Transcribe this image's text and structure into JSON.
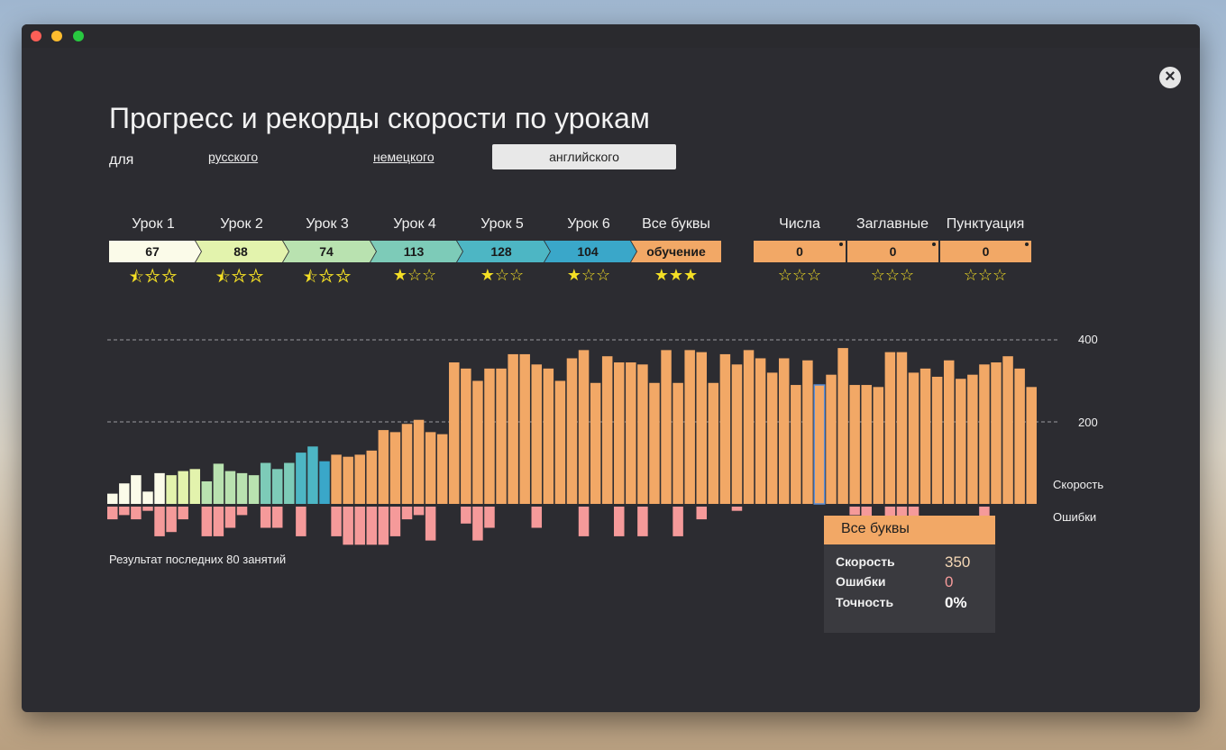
{
  "window": {
    "title": ""
  },
  "page_title": "Прогресс и рекорды скорости по урокам",
  "for_label": "для",
  "languages": [
    {
      "label": "русского",
      "selected": false
    },
    {
      "label": "немецкого",
      "selected": false
    },
    {
      "label": "английского",
      "selected": true
    }
  ],
  "lessons": [
    {
      "label": "Урок 1",
      "value": "67",
      "stars": "half",
      "color": "#fbfbe9"
    },
    {
      "label": "Урок 2",
      "value": "88",
      "stars": "half",
      "color": "#e3f3ad"
    },
    {
      "label": "Урок 3",
      "value": "74",
      "stars": "half",
      "color": "#b9e2b0"
    },
    {
      "label": "Урок 4",
      "value": "113",
      "stars": "one",
      "color": "#7dcbb8"
    },
    {
      "label": "Урок 5",
      "value": "128",
      "stars": "one",
      "color": "#4db6c4"
    },
    {
      "label": "Урок 6",
      "value": "104",
      "stars": "one",
      "color": "#3aa7c9"
    },
    {
      "label": "Все буквы",
      "value": "обучение",
      "stars": "three",
      "color": "#f2a866"
    }
  ],
  "extras": [
    {
      "label": "Числа",
      "value": "0",
      "stars": "zero"
    },
    {
      "label": "Заглавные",
      "value": "0",
      "stars": "zero"
    },
    {
      "label": "Пунктуация",
      "value": "0",
      "stars": "zero"
    }
  ],
  "star_glyphs": {
    "half": "⯪☆☆",
    "one": "★☆☆",
    "three": "★★★",
    "zero": "☆☆☆"
  },
  "chart_data": {
    "type": "bar",
    "y_ticks": [
      "400",
      "200"
    ],
    "ylim": [
      0,
      400
    ],
    "speed_label": "Скорость",
    "errors_label": "Ошибки",
    "colors": [
      "#fbfbe9",
      "#e3f3ad",
      "#b9e2b0",
      "#7dcbb8",
      "#4db6c4",
      "#3aa7c9",
      "#f2a866"
    ],
    "error_color": "#f59a9a",
    "bars": [
      {
        "v": 25,
        "g": 0,
        "e": 3
      },
      {
        "v": 50,
        "g": 0,
        "e": 2
      },
      {
        "v": 70,
        "g": 0,
        "e": 3
      },
      {
        "v": 30,
        "g": 0,
        "e": 1
      },
      {
        "v": 75,
        "g": 0,
        "e": 7
      },
      {
        "v": 70,
        "g": 1,
        "e": 6
      },
      {
        "v": 80,
        "g": 1,
        "e": 3
      },
      {
        "v": 85,
        "g": 1,
        "e": 0
      },
      {
        "v": 55,
        "g": 2,
        "e": 7
      },
      {
        "v": 98,
        "g": 2,
        "e": 7
      },
      {
        "v": 80,
        "g": 2,
        "e": 5
      },
      {
        "v": 75,
        "g": 2,
        "e": 2
      },
      {
        "v": 70,
        "g": 2,
        "e": 0
      },
      {
        "v": 100,
        "g": 3,
        "e": 5
      },
      {
        "v": 85,
        "g": 3,
        "e": 5
      },
      {
        "v": 100,
        "g": 3,
        "e": 0
      },
      {
        "v": 125,
        "g": 4,
        "e": 7
      },
      {
        "v": 140,
        "g": 4,
        "e": 0
      },
      {
        "v": 104,
        "g": 5,
        "e": 0
      },
      {
        "v": 120,
        "g": 6,
        "e": 7
      },
      {
        "v": 115,
        "g": 6,
        "e": 9
      },
      {
        "v": 120,
        "g": 6,
        "e": 9
      },
      {
        "v": 130,
        "g": 6,
        "e": 9
      },
      {
        "v": 180,
        "g": 6,
        "e": 9
      },
      {
        "v": 175,
        "g": 6,
        "e": 7
      },
      {
        "v": 195,
        "g": 6,
        "e": 3
      },
      {
        "v": 205,
        "g": 6,
        "e": 2
      },
      {
        "v": 175,
        "g": 6,
        "e": 8
      },
      {
        "v": 170,
        "g": 6,
        "e": 0
      },
      {
        "v": 345,
        "g": 6,
        "e": 0
      },
      {
        "v": 330,
        "g": 6,
        "e": 4
      },
      {
        "v": 300,
        "g": 6,
        "e": 8
      },
      {
        "v": 330,
        "g": 6,
        "e": 5
      },
      {
        "v": 330,
        "g": 6,
        "e": 0
      },
      {
        "v": 365,
        "g": 6,
        "e": 0
      },
      {
        "v": 365,
        "g": 6,
        "e": 0
      },
      {
        "v": 340,
        "g": 6,
        "e": 5
      },
      {
        "v": 330,
        "g": 6,
        "e": 0
      },
      {
        "v": 300,
        "g": 6,
        "e": 0
      },
      {
        "v": 355,
        "g": 6,
        "e": 0
      },
      {
        "v": 375,
        "g": 6,
        "e": 7
      },
      {
        "v": 295,
        "g": 6,
        "e": 0
      },
      {
        "v": 360,
        "g": 6,
        "e": 0
      },
      {
        "v": 345,
        "g": 6,
        "e": 7
      },
      {
        "v": 345,
        "g": 6,
        "e": 0
      },
      {
        "v": 340,
        "g": 6,
        "e": 7
      },
      {
        "v": 295,
        "g": 6,
        "e": 0
      },
      {
        "v": 375,
        "g": 6,
        "e": 0
      },
      {
        "v": 295,
        "g": 6,
        "e": 7
      },
      {
        "v": 375,
        "g": 6,
        "e": 0
      },
      {
        "v": 370,
        "g": 6,
        "e": 3
      },
      {
        "v": 295,
        "g": 6,
        "e": 0
      },
      {
        "v": 365,
        "g": 6,
        "e": 0
      },
      {
        "v": 340,
        "g": 6,
        "e": 1
      },
      {
        "v": 375,
        "g": 6,
        "e": 0
      },
      {
        "v": 355,
        "g": 6,
        "e": 0
      },
      {
        "v": 320,
        "g": 6,
        "e": 0
      },
      {
        "v": 355,
        "g": 6,
        "e": 0
      },
      {
        "v": 290,
        "g": 6,
        "e": 0
      },
      {
        "v": 350,
        "g": 6,
        "e": 0
      },
      {
        "v": 290,
        "g": 6,
        "e": 0
      },
      {
        "v": 315,
        "g": 6,
        "e": 0
      },
      {
        "v": 380,
        "g": 6,
        "e": 0
      },
      {
        "v": 290,
        "g": 6,
        "e": 2
      },
      {
        "v": 290,
        "g": 6,
        "e": 4
      },
      {
        "v": 285,
        "g": 6,
        "e": 0
      },
      {
        "v": 370,
        "g": 6,
        "e": 4
      },
      {
        "v": 370,
        "g": 6,
        "e": 5
      },
      {
        "v": 320,
        "g": 6,
        "e": 8
      },
      {
        "v": 330,
        "g": 6,
        "e": 0
      },
      {
        "v": 310,
        "g": 6,
        "e": 0
      },
      {
        "v": 350,
        "g": 6,
        "e": 0
      },
      {
        "v": 305,
        "g": 6,
        "e": 0
      },
      {
        "v": 315,
        "g": 6,
        "e": 0
      },
      {
        "v": 340,
        "g": 6,
        "e": 7
      },
      {
        "v": 345,
        "g": 6,
        "e": 0
      },
      {
        "v": 360,
        "g": 6,
        "e": 0
      },
      {
        "v": 330,
        "g": 6,
        "e": 0
      },
      {
        "v": 285,
        "g": 6,
        "e": 0
      }
    ],
    "highlighted_index": 60
  },
  "footer_note": "Результат последних 80 занятий",
  "tooltip": {
    "title": "Все буквы",
    "rows": [
      {
        "label": "Скорость",
        "value": "350",
        "color": "#f5d8b6"
      },
      {
        "label": "Ошибки",
        "value": "0",
        "color": "#f59a9a"
      },
      {
        "label": "Точность",
        "value": "0%",
        "color": "#ffffff"
      }
    ]
  }
}
